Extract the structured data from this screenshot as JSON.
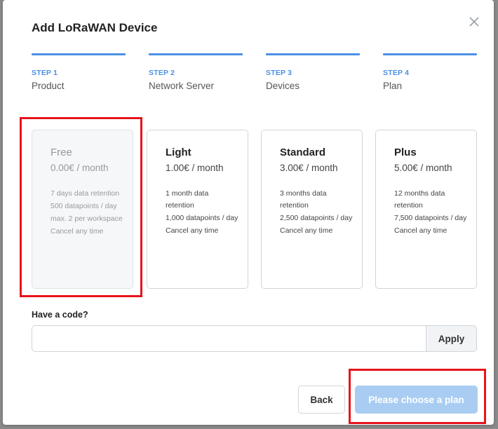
{
  "dialog": {
    "title": "Add LoRaWAN Device"
  },
  "steps": [
    {
      "number": "STEP 1",
      "name": "Product"
    },
    {
      "number": "STEP 2",
      "name": "Network Server"
    },
    {
      "number": "STEP 3",
      "name": "Devices"
    },
    {
      "number": "STEP 4",
      "name": "Plan"
    }
  ],
  "plans": [
    {
      "name": "Free",
      "price": "0.00€ / month",
      "features": [
        "7 days data retention",
        "500 datapoints / day",
        "max. 2 per workspace",
        "Cancel any time"
      ],
      "disabled": true
    },
    {
      "name": "Light",
      "price": "1.00€ / month",
      "features": [
        "1 month data retention",
        "1,000 datapoints / day",
        "Cancel any time"
      ],
      "disabled": false
    },
    {
      "name": "Standard",
      "price": "3.00€ / month",
      "features": [
        "3 months data retention",
        "2,500 datapoints / day",
        "Cancel any time"
      ],
      "disabled": false
    },
    {
      "name": "Plus",
      "price": "5.00€ / month",
      "features": [
        "12 months data retention",
        "7,500 datapoints / day",
        "Cancel any time"
      ],
      "disabled": false
    }
  ],
  "code": {
    "label": "Have a code?",
    "value": "",
    "placeholder": "",
    "apply_label": "Apply"
  },
  "footer": {
    "back_label": "Back",
    "choose_label": "Please choose a plan"
  },
  "icons": {
    "close": "close-icon"
  },
  "colors": {
    "accent": "#4a90e2",
    "primary_disabled": "#a9cdf2",
    "highlight": "#e8141b"
  }
}
